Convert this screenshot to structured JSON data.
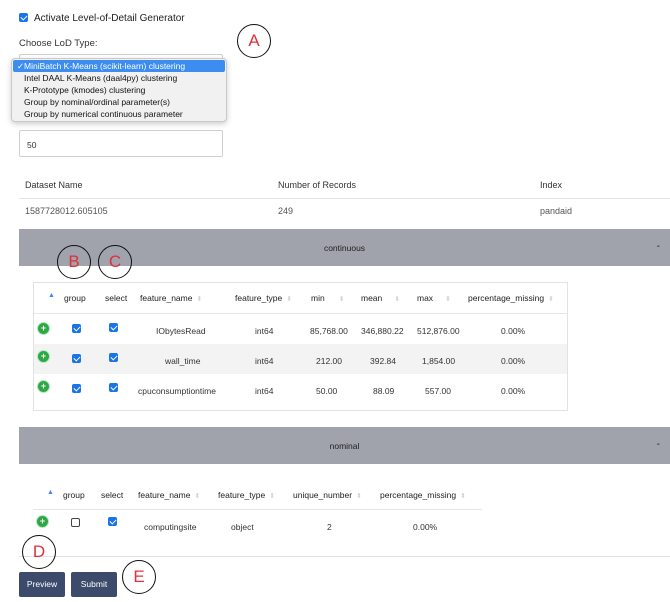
{
  "activate_label": "Activate Level-of-Detail Generator",
  "activate_checked": true,
  "lod_type_label": "Choose LoD Type:",
  "lod_options": [
    "MiniBatch K-Means (scikit-learn) clustering",
    "Intel DAAL K-Means (daal4py) clustering",
    "K-Prototype (kmodes) clustering",
    "Group by nominal/ordinal parameter(s)",
    "Group by numerical continuous parameter"
  ],
  "lod_selected_index": 0,
  "lod_value_input": "50",
  "dataset_table": {
    "headers": [
      "Dataset Name",
      "Number of Records",
      "Index"
    ],
    "row": [
      "1587728012.605105",
      "249",
      "pandaid"
    ]
  },
  "continuous": {
    "title": "continuous",
    "toggle": "-",
    "columns": [
      "group",
      "select",
      "feature_name",
      "feature_type",
      "min",
      "mean",
      "max",
      "percentage_missing"
    ],
    "rows": [
      {
        "group": true,
        "select": true,
        "feature_name": "IObytesRead",
        "feature_type": "int64",
        "min": "85,768.00",
        "mean": "346,880.22",
        "max": "512,876.00",
        "percentage_missing": "0.00%"
      },
      {
        "group": true,
        "select": true,
        "feature_name": "wall_time",
        "feature_type": "int64",
        "min": "212.00",
        "mean": "392.84",
        "max": "1,854.00",
        "percentage_missing": "0.00%"
      },
      {
        "group": true,
        "select": true,
        "feature_name": "cpuconsumptiontime",
        "feature_type": "int64",
        "min": "50.00",
        "mean": "88.09",
        "max": "557.00",
        "percentage_missing": "0.00%"
      }
    ]
  },
  "nominal": {
    "title": "nominal",
    "toggle": "-",
    "columns": [
      "group",
      "select",
      "feature_name",
      "feature_type",
      "unique_number",
      "percentage_missing"
    ],
    "rows": [
      {
        "group": false,
        "select": true,
        "feature_name": "computingsite",
        "feature_type": "object",
        "unique_number": "2",
        "percentage_missing": "0.00%"
      }
    ]
  },
  "buttons": {
    "preview": "Preview",
    "submit": "Submit"
  },
  "annotations": {
    "a": "A",
    "b": "B",
    "c": "C",
    "d": "D",
    "e": "E"
  },
  "colors": {
    "accent": "#1a73e8",
    "section_bar": "#a0a3ab",
    "button": "#3c4b6b",
    "annotation_letter": "#e0303a",
    "row_add": "#2ea845"
  },
  "icons": {
    "row_expand": "plus-circle-icon",
    "sort": "sort-arrows-icon",
    "dropdown_check": "checkmark-icon"
  }
}
